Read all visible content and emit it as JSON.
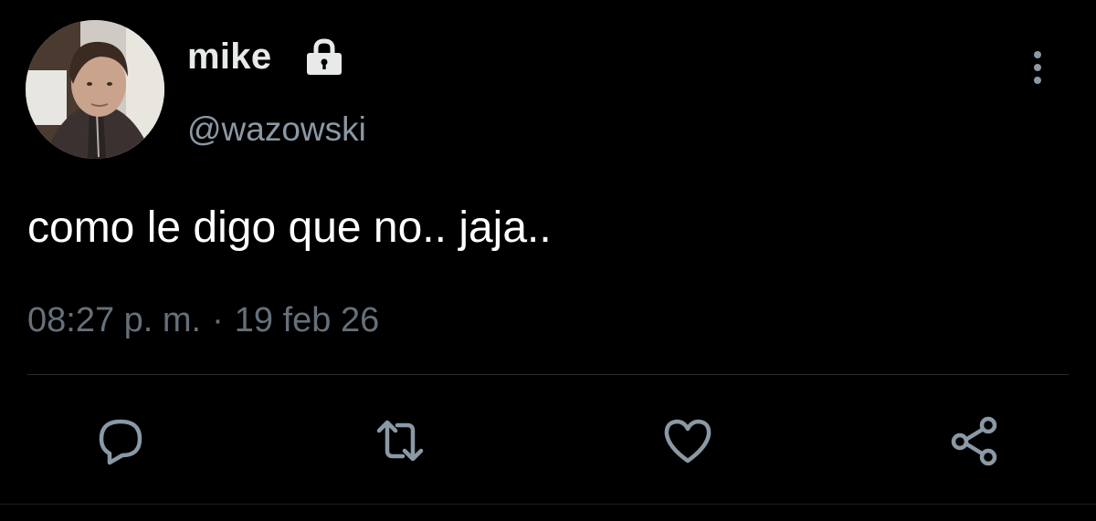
{
  "tweet": {
    "display_name": "mike",
    "handle": "@wazowski",
    "text": "como le digo que no.. jaja..",
    "time": "08:27 p. m.",
    "separator": "·",
    "date": "19 feb 26",
    "protected": true
  },
  "icons": {
    "lock": "lock-icon",
    "more": "more-vertical-icon",
    "reply": "reply-icon",
    "retweet": "retweet-icon",
    "like": "heart-icon",
    "share": "share-icon"
  },
  "colors": {
    "background": "#000000",
    "name": "#e7e9ea",
    "handle": "#8b98a5",
    "meta": "#66707a",
    "icon": "#8b98a5",
    "divider": "#2a2f33"
  }
}
